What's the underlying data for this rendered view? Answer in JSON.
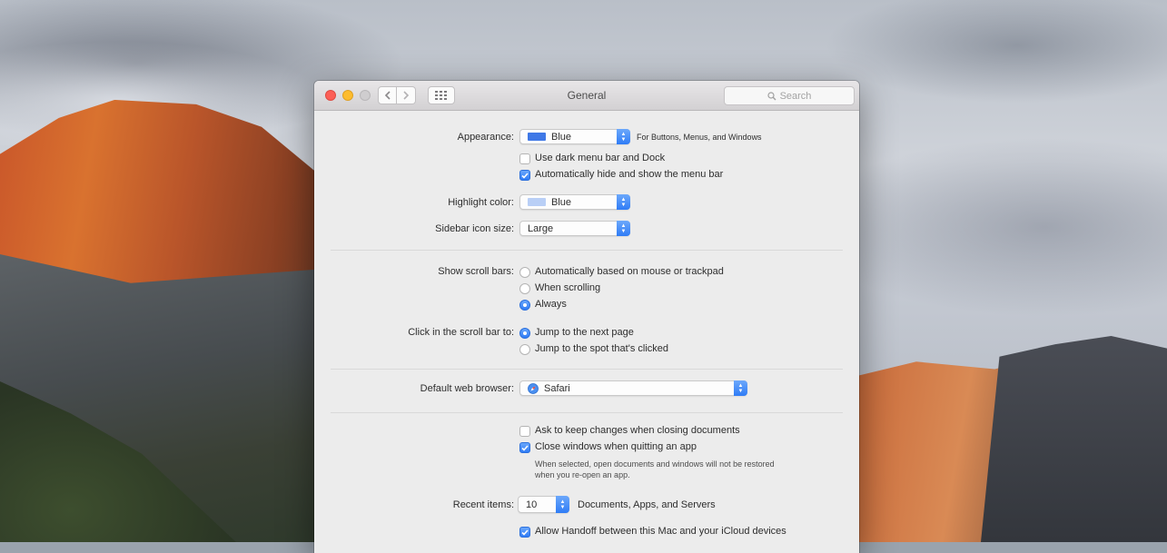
{
  "window": {
    "title": "General",
    "search_placeholder": "Search",
    "back_icon": "chevron-left-icon",
    "forward_icon": "chevron-right-icon",
    "grid_icon": "show-all-grid-icon"
  },
  "appearance": {
    "label": "Appearance:",
    "value": "Blue",
    "swatch_color": "#3f78e6",
    "suffix": "For Buttons, Menus, and Windows",
    "dark_menu": {
      "label": "Use dark menu bar and Dock",
      "checked": false
    },
    "auto_hide": {
      "label": "Automatically hide and show the menu bar",
      "checked": true
    }
  },
  "highlight": {
    "label": "Highlight color:",
    "value": "Blue",
    "swatch_color": "#b9cff6"
  },
  "sidebar_size": {
    "label": "Sidebar icon size:",
    "value": "Large"
  },
  "scroll_bars": {
    "label": "Show scroll bars:",
    "options": [
      {
        "label": "Automatically based on mouse or trackpad",
        "selected": false
      },
      {
        "label": "When scrolling",
        "selected": false
      },
      {
        "label": "Always",
        "selected": true
      }
    ]
  },
  "scroll_click": {
    "label": "Click in the scroll bar to:",
    "options": [
      {
        "label": "Jump to the next page",
        "selected": true
      },
      {
        "label": "Jump to the spot that's clicked",
        "selected": false
      }
    ]
  },
  "browser": {
    "label": "Default web browser:",
    "value": "Safari",
    "icon": "safari-compass-icon"
  },
  "ask_keep": {
    "label": "Ask to keep changes when closing documents",
    "checked": false
  },
  "close_windows": {
    "label": "Close windows when quitting an app",
    "checked": true,
    "note_line1": "When selected, open documents and windows will not be restored",
    "note_line2": "when you re-open an app."
  },
  "recent": {
    "label": "Recent items:",
    "value": "10",
    "suffix": "Documents, Apps, and Servers"
  },
  "handoff": {
    "label": "Allow Handoff between this Mac and your iCloud devices",
    "checked": true
  }
}
